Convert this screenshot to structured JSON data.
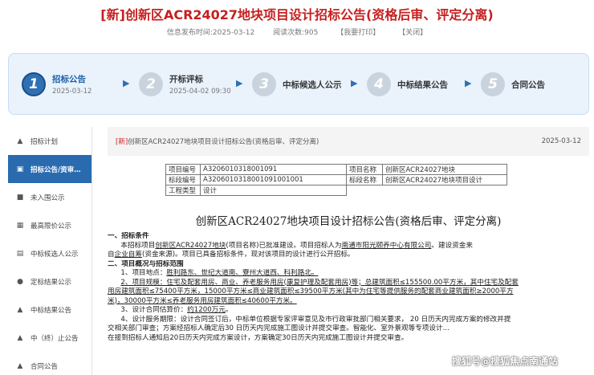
{
  "header": {
    "tag": "[新]",
    "title": "创新区ACR24027地块项目设计招标公告(资格后审、评定分离)",
    "publish_time": "信息发布时间:2025-03-12",
    "views": "阅读次数:905",
    "print_link": "【我要打印】",
    "close_link": "【关闭】"
  },
  "steps": [
    {
      "num": "1",
      "label": "招标公告",
      "date": "2025-03-12"
    },
    {
      "num": "2",
      "label": "开标评标",
      "date": "2025-04-02 09:30"
    },
    {
      "num": "3",
      "label": "中标候选人公示",
      "date": ""
    },
    {
      "num": "4",
      "label": "中标结果公告",
      "date": ""
    },
    {
      "num": "5",
      "label": "合同公告",
      "date": ""
    }
  ],
  "sidebar": {
    "items": [
      {
        "label": "招标计划",
        "icon": "bell-icon"
      },
      {
        "label": "招标公告/资审…",
        "icon": "document-icon"
      },
      {
        "label": "未入围公示",
        "icon": "building-icon"
      },
      {
        "label": "最高限价公示",
        "icon": "price-card-icon"
      },
      {
        "label": "中标候选人公示",
        "icon": "clipboard-icon"
      },
      {
        "label": "定标结果公示",
        "icon": "person-icon"
      },
      {
        "label": "中标结果公告",
        "icon": "bell-icon"
      },
      {
        "label": "中（终）止公告",
        "icon": "bell-icon"
      },
      {
        "label": "合同公告",
        "icon": "bell-icon"
      }
    ]
  },
  "content": {
    "crumb_tag": "[新]",
    "crumb_title": "创新区ACR24027地块项目设计招标公告(资格后审、评定分离)",
    "crumb_date": "2025-03-12",
    "info_table": {
      "project_no_label": "项目编号",
      "project_no": "A3206010318001091",
      "project_name_label": "项目名称",
      "project_name": "创新区ACR24027地块",
      "section_no_label": "标段编号",
      "section_no": "A3206010318001091001001",
      "section_name_label": "标段名称",
      "section_name": "创新区ACR24027地块项目设计",
      "type_label": "工程类型",
      "type": "设计"
    },
    "announcement_title": "创新区ACR24027地块项目设计招标公告(资格后审、评定分离)",
    "sec1_heading": "一、招标条件",
    "sec1_p1a": "本招标项目",
    "sec1_p1b": "创新区ACR24027地块",
    "sec1_p1c": "(项目名称)已批准建设。项目招标人为",
    "sec1_p1d": "南通市阳光颐养中心有限公司",
    "sec1_p1e": "。建设资金来",
    "sec1_p2a": "自",
    "sec1_p2b": "企业自筹",
    "sec1_p2c": "(资金来源)。项目已具备招标条件，现对该项目的设计进行公开招标。",
    "sec2_heading": "二、项目概况与招标范围",
    "p_location_a": "1、项目地点：",
    "p_location_b": "胜利路东、世纪大道南、寮州大道西、科利路北。",
    "p_scale_1": "2、项目规模：住宅及配套用房、商业、养老服务用房(康复护理及配套用房)等；总建筑面积≤155500.00平方米，其中住宅及配套",
    "p_scale_2": "用房建筑面积≤75400平方米，15000平方米≤商业建筑面积≤39500平方米(其中为住宅等提供服务的配套商业建筑面积≥2000平方",
    "p_scale_3": "米)，30000平方米≤养老服务用房建筑面积≤40600平方米。",
    "p_price_a": "3、设计合同估算价：",
    "p_price_b": "约1200万元",
    "p_price_c": "。",
    "p_period_1": "4、设计服务期限：设计合同签订后，中标单位根据专家评审意见及市行政审批部门相关要求，   20  日历天内完成方案的修改并提",
    "p_period_2": "交相关部门审查；方案经招标人确定后30   日历天内完成施工图设计并提交审查。智能化、室外景观等专项设计...",
    "p_period_3": "在接到招标人通知后20日历天内完成方案设计，方案确定30日历天内完成施工图设计并提交审查。"
  },
  "watermark": "搜狐号@搜狐焦点南通站"
}
